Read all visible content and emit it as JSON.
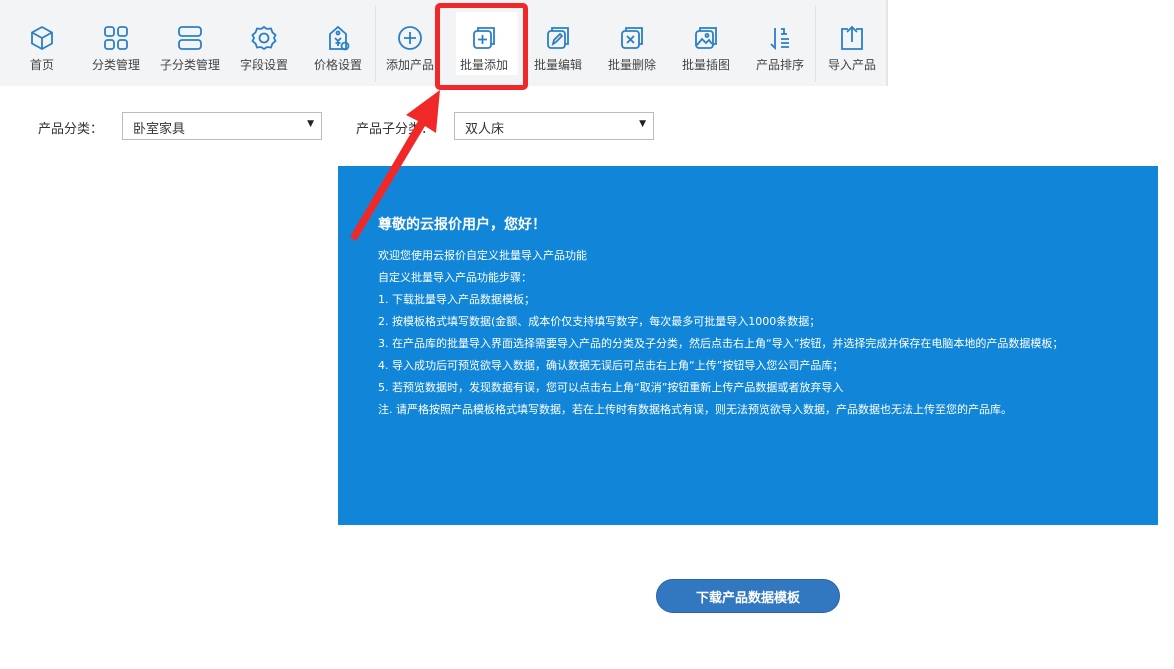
{
  "toolbar": {
    "items": [
      {
        "label": "首页",
        "icon": "cube-icon"
      },
      {
        "label": "分类管理",
        "icon": "grid-icon"
      },
      {
        "label": "子分类管理",
        "icon": "stack-icon"
      },
      {
        "label": "字段设置",
        "icon": "gear-icon"
      },
      {
        "label": "价格设置",
        "icon": "price-tag-icon"
      },
      {
        "label": "添加产品",
        "icon": "plus-circle-icon"
      },
      {
        "label": "批量添加",
        "icon": "batch-add-icon"
      },
      {
        "label": "批量编辑",
        "icon": "batch-edit-icon"
      },
      {
        "label": "批量删除",
        "icon": "batch-delete-icon"
      },
      {
        "label": "批量插图",
        "icon": "batch-image-icon"
      },
      {
        "label": "产品排序",
        "icon": "sort-icon"
      },
      {
        "label": "导入产品",
        "icon": "import-icon"
      }
    ],
    "active": "批量添加",
    "icon_color": "#2a7fc8"
  },
  "filters": {
    "category_label": "产品分类：",
    "category_value": "卧室家具",
    "subcategory_label": "产品子分类：",
    "subcategory_value": "双人床"
  },
  "info": {
    "title": "尊敬的云报价用户，您好！",
    "lines": [
      "欢迎您使用云报价自定义批量导入产品功能",
      "自定义批量导入产品功能步骤：",
      "1. 下载批量导入产品数据模板；",
      "2. 按模板格式填写数据(金额、成本价仅支持填写数字，每次最多可批量导入1000条数据；",
      "3. 在产品库的批量导入界面选择需要导入产品的分类及子分类，然后点击右上角“导入”按钮，并选择完成并保存在电脑本地的产品数据模板；",
      "4. 导入成功后可预览欲导入数据，确认数据无误后可点击右上角“上传”按钮导入您公司产品库；",
      "5. 若预览数据时，发现数据有误，您可以点击右上角“取消”按钮重新上传产品数据或者放弃导入",
      "注. 请严格按照产品模板格式填写数据，若在上传时有数据格式有误，则无法预览欲导入数据，产品数据也无法上传至您的产品库。"
    ],
    "background": "#1186d8"
  },
  "download_button": "下载产品数据模板",
  "annotation": {
    "color": "#f02828"
  }
}
